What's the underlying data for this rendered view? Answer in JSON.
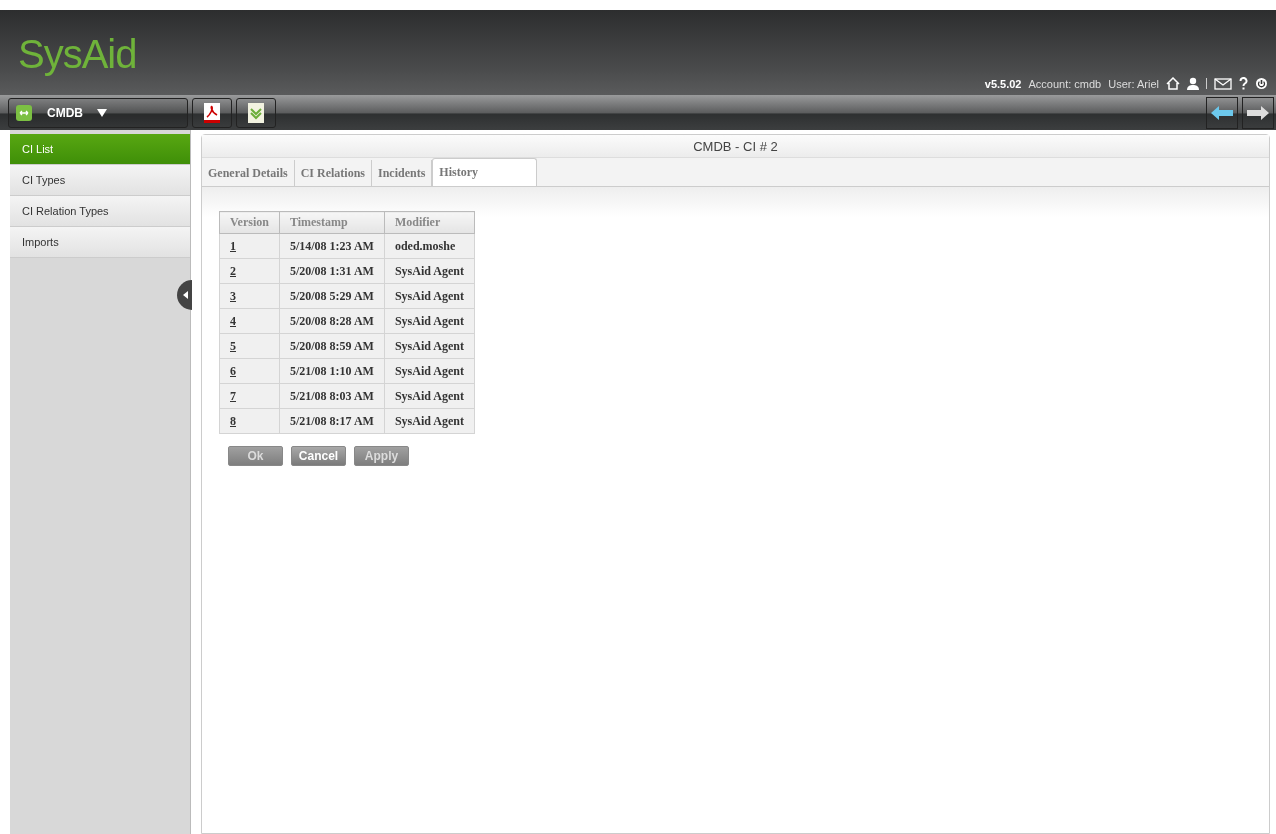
{
  "header": {
    "logo": "SysAid",
    "version": "v5.5.02",
    "account": "Account: cmdb",
    "user": "User: Ariel"
  },
  "toolbar": {
    "module": "CMDB"
  },
  "sidebar": {
    "items": [
      {
        "label": "CI List",
        "selected": true
      },
      {
        "label": "CI Types",
        "selected": false
      },
      {
        "label": "CI Relation Types",
        "selected": false
      },
      {
        "label": "Imports",
        "selected": false
      }
    ]
  },
  "panel": {
    "title": "CMDB - CI # 2"
  },
  "tabs": [
    {
      "label": "General Details",
      "selected": false
    },
    {
      "label": "CI Relations",
      "selected": false
    },
    {
      "label": "Incidents",
      "selected": false
    },
    {
      "label": "History",
      "selected": true
    }
  ],
  "table": {
    "columns": [
      "Version",
      "Timestamp",
      "Modifier"
    ],
    "rows": [
      [
        "1",
        "5/14/08 1:23 AM",
        "oded.moshe"
      ],
      [
        "2",
        "5/20/08 1:31 AM",
        "SysAid Agent"
      ],
      [
        "3",
        "5/20/08 5:29 AM",
        "SysAid Agent"
      ],
      [
        "4",
        "5/20/08 8:28 AM",
        "SysAid Agent"
      ],
      [
        "5",
        "5/20/08 8:59 AM",
        "SysAid Agent"
      ],
      [
        "6",
        "5/21/08 1:10 AM",
        "SysAid Agent"
      ],
      [
        "7",
        "5/21/08 8:03 AM",
        "SysAid Agent"
      ],
      [
        "8",
        "5/21/08 8:17 AM",
        "SysAid Agent"
      ]
    ]
  },
  "buttons": [
    {
      "label": "Ok",
      "disabled": true
    },
    {
      "label": "Cancel",
      "disabled": false
    },
    {
      "label": "Apply",
      "disabled": true
    }
  ]
}
